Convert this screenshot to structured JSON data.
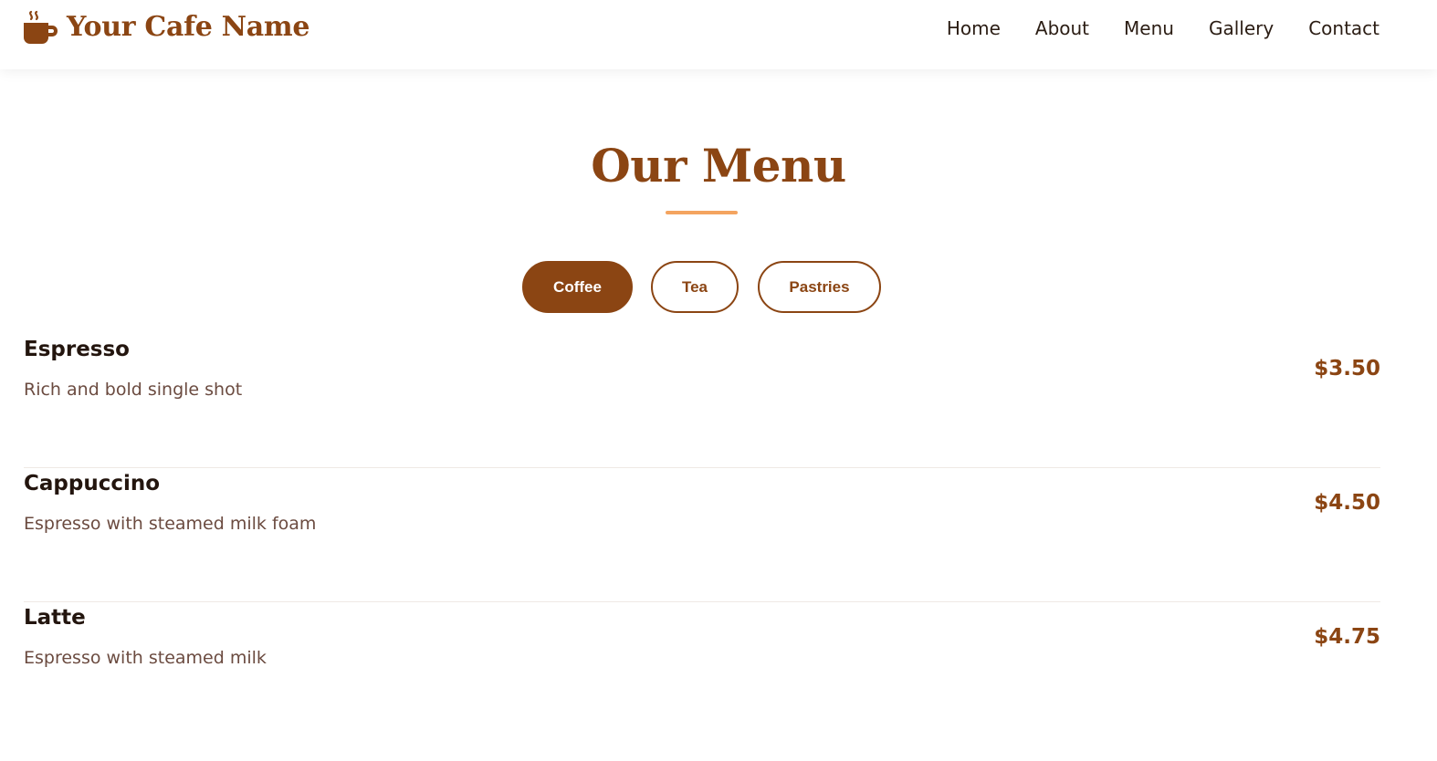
{
  "header": {
    "brand_name": "Your Cafe Name",
    "brand_icon": "coffee-cup-icon",
    "nav": [
      {
        "label": "Home"
      },
      {
        "label": "About"
      },
      {
        "label": "Menu"
      },
      {
        "label": "Gallery"
      },
      {
        "label": "Contact"
      }
    ]
  },
  "menu": {
    "title": "Our Menu",
    "tabs": [
      {
        "label": "Coffee",
        "active": true
      },
      {
        "label": "Tea",
        "active": false
      },
      {
        "label": "Pastries",
        "active": false
      }
    ],
    "items": [
      {
        "name": "Espresso",
        "description": "Rich and bold single shot",
        "price": "$3.50"
      },
      {
        "name": "Cappuccino",
        "description": "Espresso with steamed milk foam",
        "price": "$4.50"
      },
      {
        "name": "Latte",
        "description": "Espresso with steamed milk",
        "price": "$4.75"
      }
    ]
  },
  "colors": {
    "brand": "#8b4513",
    "accent": "#f4a460",
    "text_dark": "#23150e",
    "text_muted": "#6b4b40"
  }
}
